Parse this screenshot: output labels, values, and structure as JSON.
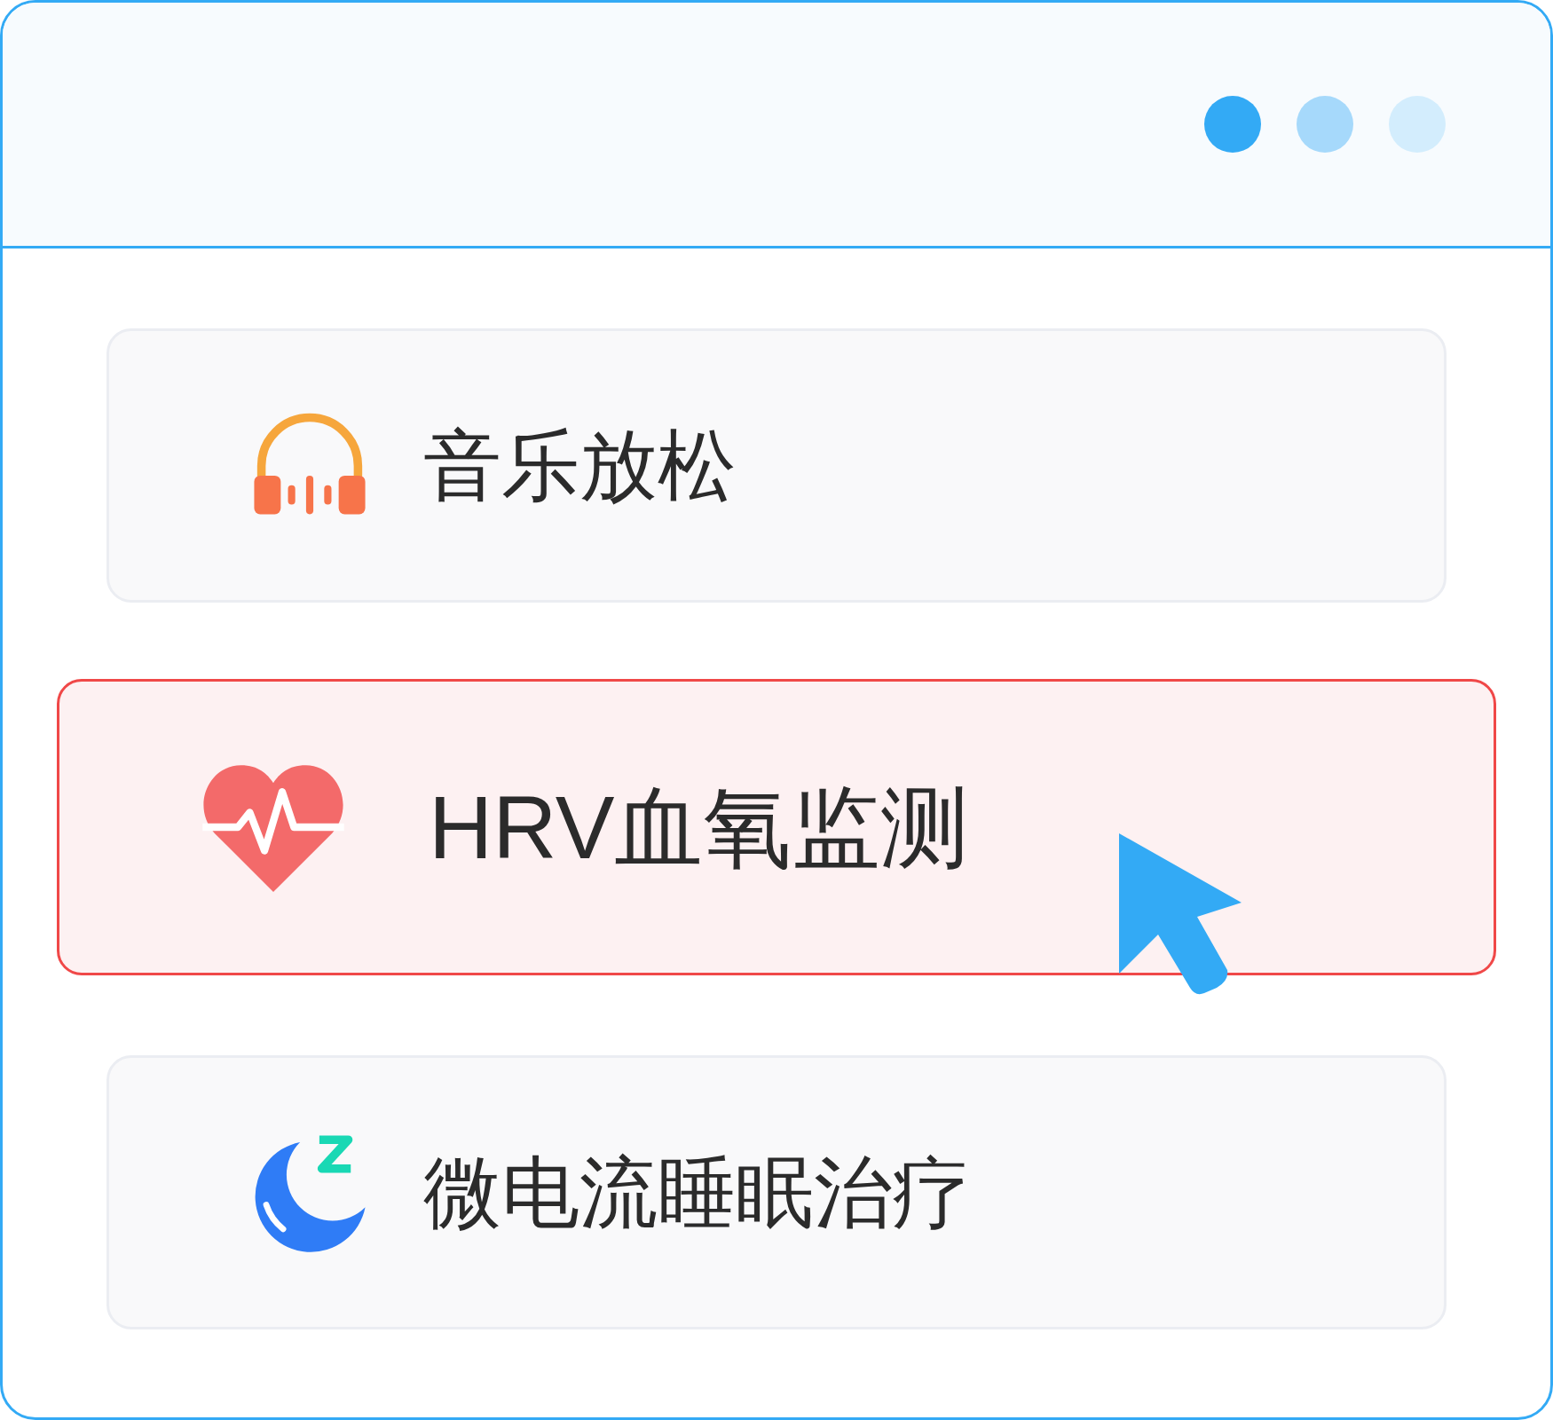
{
  "window": {
    "dots": [
      {
        "color": "#33aaf5"
      },
      {
        "color": "#a6d9fb"
      },
      {
        "color": "#d3edfd"
      }
    ]
  },
  "items": [
    {
      "kind": "music",
      "label": "音乐放松",
      "selected": false
    },
    {
      "kind": "heart",
      "label": "HRV血氧监测",
      "selected": true
    },
    {
      "kind": "sleep",
      "label": "微电流睡眠治疗",
      "selected": false
    }
  ]
}
